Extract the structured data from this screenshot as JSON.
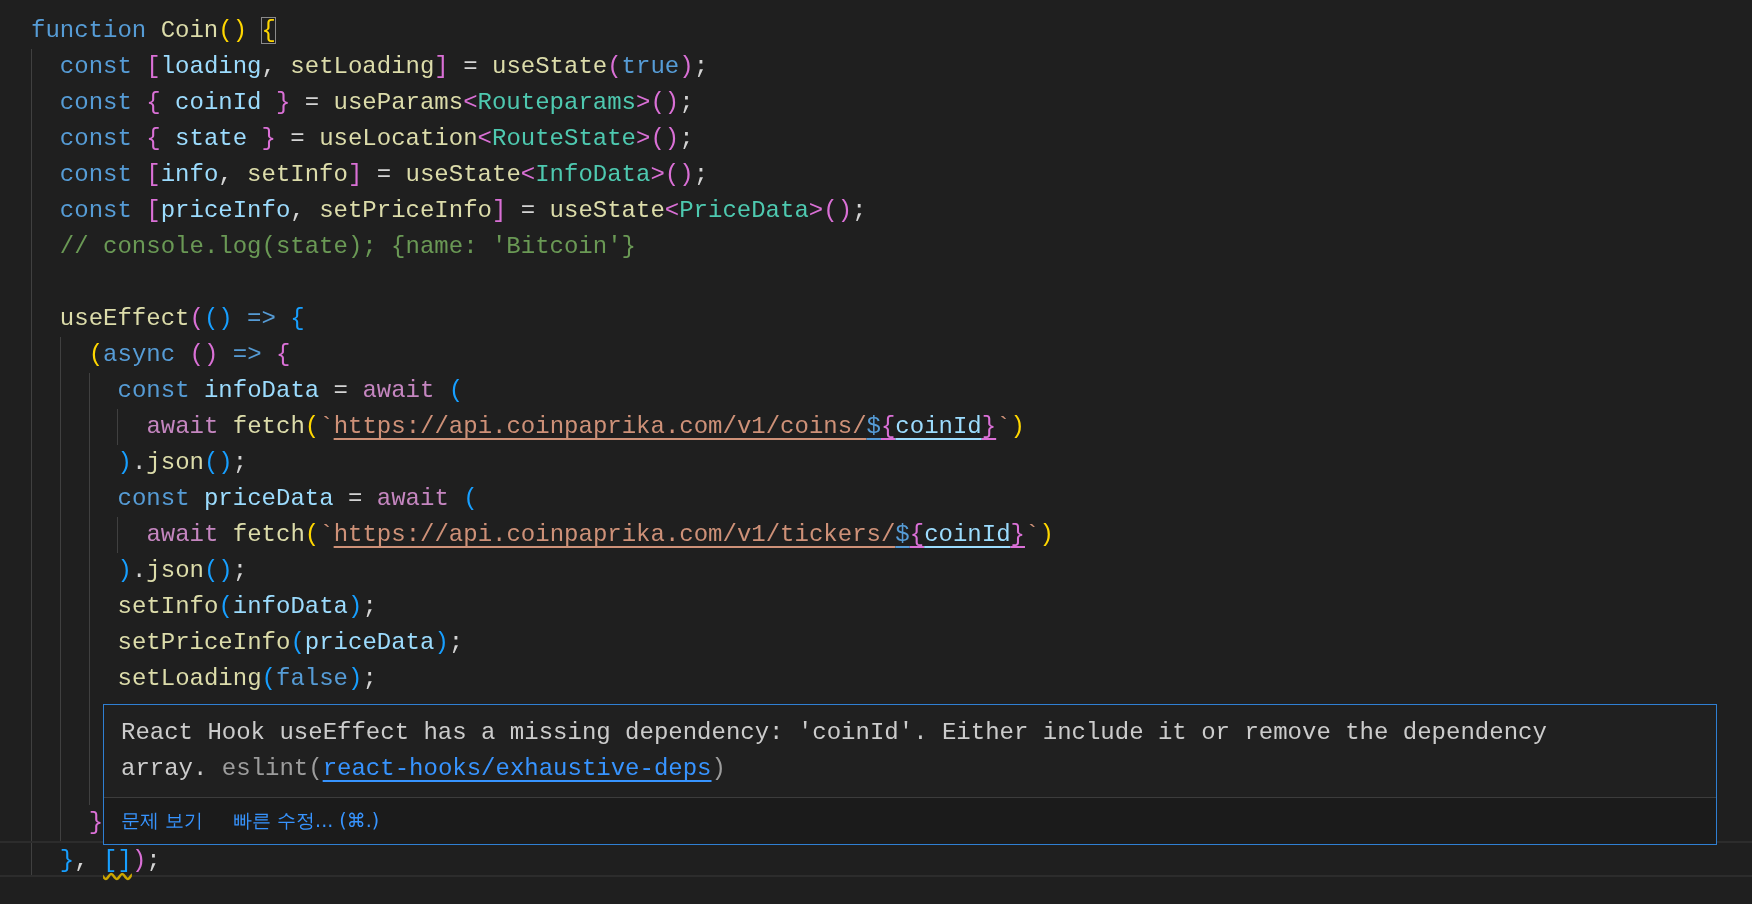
{
  "editor": {
    "lines": [
      {
        "kind": "code",
        "current": false,
        "tokens": [
          {
            "kind": "k",
            "text": "function "
          },
          {
            "kind": "f",
            "text": "Coin"
          },
          {
            "kind": "b1",
            "text": "() "
          },
          {
            "kind": "b1_m",
            "text": "{"
          }
        ]
      },
      {
        "kind": "code",
        "current": false,
        "tokens": [
          {
            "kind": "k",
            "text": "  const "
          },
          {
            "kind": "b2",
            "text": "["
          },
          {
            "kind": "v",
            "text": "loading"
          },
          {
            "kind": "p",
            "text": ", "
          },
          {
            "kind": "f",
            "text": "setLoading"
          },
          {
            "kind": "b2",
            "text": "]"
          },
          {
            "kind": "p",
            "text": " = "
          },
          {
            "kind": "f",
            "text": "useState"
          },
          {
            "kind": "b2",
            "text": "("
          },
          {
            "kind": "k",
            "text": "true"
          },
          {
            "kind": "b2",
            "text": ")"
          },
          {
            "kind": "p",
            "text": ";"
          }
        ]
      },
      {
        "kind": "code",
        "current": false,
        "tokens": [
          {
            "kind": "k",
            "text": "  const "
          },
          {
            "kind": "b2",
            "text": "{"
          },
          {
            "kind": "v",
            "text": " coinId "
          },
          {
            "kind": "b2",
            "text": "}"
          },
          {
            "kind": "p",
            "text": " = "
          },
          {
            "kind": "f",
            "text": "useParams"
          },
          {
            "kind": "b2",
            "text": "<"
          },
          {
            "kind": "t",
            "text": "Routeparams"
          },
          {
            "kind": "b2",
            "text": ">()"
          },
          {
            "kind": "p",
            "text": ";"
          }
        ]
      },
      {
        "kind": "code",
        "current": false,
        "tokens": [
          {
            "kind": "k",
            "text": "  const "
          },
          {
            "kind": "b2",
            "text": "{"
          },
          {
            "kind": "v",
            "text": " state "
          },
          {
            "kind": "b2",
            "text": "}"
          },
          {
            "kind": "p",
            "text": " = "
          },
          {
            "kind": "f",
            "text": "useLocation"
          },
          {
            "kind": "b2",
            "text": "<"
          },
          {
            "kind": "t",
            "text": "RouteState"
          },
          {
            "kind": "b2",
            "text": ">()"
          },
          {
            "kind": "p",
            "text": ";"
          }
        ]
      },
      {
        "kind": "code",
        "current": false,
        "tokens": [
          {
            "kind": "k",
            "text": "  const "
          },
          {
            "kind": "b2",
            "text": "["
          },
          {
            "kind": "v",
            "text": "info"
          },
          {
            "kind": "p",
            "text": ", "
          },
          {
            "kind": "f",
            "text": "setInfo"
          },
          {
            "kind": "b2",
            "text": "]"
          },
          {
            "kind": "p",
            "text": " = "
          },
          {
            "kind": "f",
            "text": "useState"
          },
          {
            "kind": "b2",
            "text": "<"
          },
          {
            "kind": "t",
            "text": "InfoData"
          },
          {
            "kind": "b2",
            "text": ">()"
          },
          {
            "kind": "p",
            "text": ";"
          }
        ]
      },
      {
        "kind": "code",
        "current": false,
        "tokens": [
          {
            "kind": "k",
            "text": "  const "
          },
          {
            "kind": "b2",
            "text": "["
          },
          {
            "kind": "v",
            "text": "priceInfo"
          },
          {
            "kind": "p",
            "text": ", "
          },
          {
            "kind": "f",
            "text": "setPriceInfo"
          },
          {
            "kind": "b2",
            "text": "]"
          },
          {
            "kind": "p",
            "text": " = "
          },
          {
            "kind": "f",
            "text": "useState"
          },
          {
            "kind": "b2",
            "text": "<"
          },
          {
            "kind": "t",
            "text": "PriceData"
          },
          {
            "kind": "b2",
            "text": ">()"
          },
          {
            "kind": "p",
            "text": ";"
          }
        ]
      },
      {
        "kind": "code",
        "current": false,
        "tokens": [
          {
            "kind": "c",
            "text": "  // console.log(state); {name: 'Bitcoin'}"
          }
        ]
      },
      {
        "kind": "blank",
        "current": false
      },
      {
        "kind": "code",
        "current": false,
        "tokens": [
          {
            "kind": "f",
            "text": "  useEffect"
          },
          {
            "kind": "b2",
            "text": "("
          },
          {
            "kind": "b3",
            "text": "() "
          },
          {
            "kind": "k",
            "text": "=> "
          },
          {
            "kind": "b3",
            "text": "{"
          }
        ]
      },
      {
        "kind": "code",
        "current": false,
        "tokens": [
          {
            "kind": "b1",
            "text": "    ("
          },
          {
            "kind": "k",
            "text": "async "
          },
          {
            "kind": "b2",
            "text": "() "
          },
          {
            "kind": "k",
            "text": "=> "
          },
          {
            "kind": "b2",
            "text": "{"
          }
        ]
      },
      {
        "kind": "code",
        "current": false,
        "tokens": [
          {
            "kind": "k",
            "text": "      const "
          },
          {
            "kind": "v",
            "text": "infoData"
          },
          {
            "kind": "p",
            "text": " = "
          },
          {
            "kind": "a",
            "text": "await "
          },
          {
            "kind": "b3",
            "text": "("
          }
        ]
      },
      {
        "kind": "code",
        "current": false,
        "tokens": [
          {
            "kind": "a",
            "text": "        await "
          },
          {
            "kind": "f",
            "text": "fetch"
          },
          {
            "kind": "b1",
            "text": "("
          },
          {
            "kind": "s",
            "text": "`"
          },
          {
            "kind": "s_u",
            "text": "https://api.coinpaprika.com/v1/coins/"
          },
          {
            "kind": "k_u",
            "text": "$"
          },
          {
            "kind": "b2_u",
            "text": "{"
          },
          {
            "kind": "v_u",
            "text": "coinId"
          },
          {
            "kind": "b2_u",
            "text": "}"
          },
          {
            "kind": "s",
            "text": "`"
          },
          {
            "kind": "b1",
            "text": ")"
          }
        ]
      },
      {
        "kind": "code",
        "current": false,
        "tokens": [
          {
            "kind": "b3",
            "text": "      )"
          },
          {
            "kind": "p",
            "text": "."
          },
          {
            "kind": "f",
            "text": "json"
          },
          {
            "kind": "b3",
            "text": "()"
          },
          {
            "kind": "p",
            "text": ";"
          }
        ]
      },
      {
        "kind": "code",
        "current": false,
        "tokens": [
          {
            "kind": "k",
            "text": "      const "
          },
          {
            "kind": "v",
            "text": "priceData"
          },
          {
            "kind": "p",
            "text": " = "
          },
          {
            "kind": "a",
            "text": "await "
          },
          {
            "kind": "b3",
            "text": "("
          }
        ]
      },
      {
        "kind": "code",
        "current": false,
        "tokens": [
          {
            "kind": "a",
            "text": "        await "
          },
          {
            "kind": "f",
            "text": "fetch"
          },
          {
            "kind": "b1",
            "text": "("
          },
          {
            "kind": "s",
            "text": "`"
          },
          {
            "kind": "s_u",
            "text": "https://api.coinpaprika.com/v1/tickers/"
          },
          {
            "kind": "k_u",
            "text": "$"
          },
          {
            "kind": "b2_u",
            "text": "{"
          },
          {
            "kind": "v_u",
            "text": "coinId"
          },
          {
            "kind": "b2_u",
            "text": "}"
          },
          {
            "kind": "s",
            "text": "`"
          },
          {
            "kind": "b1",
            "text": ")"
          }
        ]
      },
      {
        "kind": "code",
        "current": false,
        "tokens": [
          {
            "kind": "b3",
            "text": "      )"
          },
          {
            "kind": "p",
            "text": "."
          },
          {
            "kind": "f",
            "text": "json"
          },
          {
            "kind": "b3",
            "text": "()"
          },
          {
            "kind": "p",
            "text": ";"
          }
        ]
      },
      {
        "kind": "code",
        "current": false,
        "tokens": [
          {
            "kind": "f",
            "text": "      setInfo"
          },
          {
            "kind": "b3",
            "text": "("
          },
          {
            "kind": "v",
            "text": "infoData"
          },
          {
            "kind": "b3",
            "text": ")"
          },
          {
            "kind": "p",
            "text": ";"
          }
        ]
      },
      {
        "kind": "code",
        "current": false,
        "tokens": [
          {
            "kind": "f",
            "text": "      setPriceInfo"
          },
          {
            "kind": "b3",
            "text": "("
          },
          {
            "kind": "v",
            "text": "priceData"
          },
          {
            "kind": "b3",
            "text": ")"
          },
          {
            "kind": "p",
            "text": ";"
          }
        ]
      },
      {
        "kind": "code",
        "current": false,
        "tokens": [
          {
            "kind": "f",
            "text": "      setLoading"
          },
          {
            "kind": "b3",
            "text": "("
          },
          {
            "kind": "k",
            "text": "false"
          },
          {
            "kind": "b3",
            "text": ")"
          },
          {
            "kind": "p",
            "text": ";"
          }
        ]
      },
      {
        "kind": "blank",
        "current": false
      },
      {
        "kind": "blank",
        "current": false
      },
      {
        "kind": "blank",
        "current": false
      },
      {
        "kind": "code",
        "current": false,
        "tokens": [
          {
            "kind": "b2",
            "text": "    }"
          }
        ]
      },
      {
        "kind": "code",
        "current": true,
        "tokens": [
          {
            "kind": "b3",
            "text": "  }"
          },
          {
            "kind": "p",
            "text": ", "
          },
          {
            "kind": "b3_w",
            "text": "[]"
          },
          {
            "kind": "b2",
            "text": ")"
          },
          {
            "kind": "p",
            "text": ";"
          }
        ]
      }
    ]
  },
  "hover": {
    "message": "React Hook useEffect has a missing dependency: 'coinId'. Either include it or remove the dependency array. ",
    "source_prefix": "eslint(",
    "rule": "react-hooks/exhaustive-deps",
    "source_suffix": ")",
    "actions": [
      {
        "label": "문제 보기"
      },
      {
        "label": "빠른 수정... (⌘.)"
      }
    ]
  }
}
